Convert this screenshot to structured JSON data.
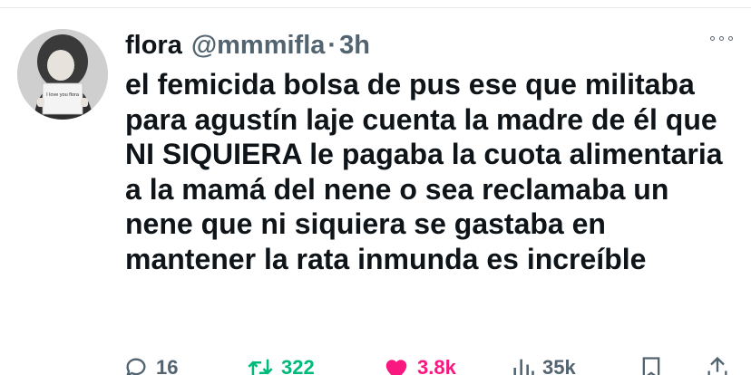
{
  "tweet": {
    "avatar": {
      "sign_text": "I love you flora"
    },
    "display_name": "flora",
    "handle": "@mmmifla",
    "separator": "·",
    "time": "3h",
    "text": "el femicida bolsa de pus ese que militaba para agustín laje cuenta la madre de él que NI SIQUIERA le pagaba la cuota alimentaria a la mamá del nene o sea reclamaba un nene que ni siquiera se gastaba en mantener la rata inmunda es increíble"
  },
  "actions": {
    "replies": "16",
    "retweets": "322",
    "likes": "3.8k",
    "views": "35k"
  },
  "colors": {
    "text": "#0f1419",
    "secondary": "#536471",
    "retweet_green": "#00ba7c",
    "like_pink": "#f91880",
    "divider": "#e7e9ea"
  },
  "icons": [
    "more-icon",
    "reply-icon",
    "retweet-icon",
    "like-icon",
    "views-icon",
    "bookmark-icon",
    "share-icon"
  ]
}
